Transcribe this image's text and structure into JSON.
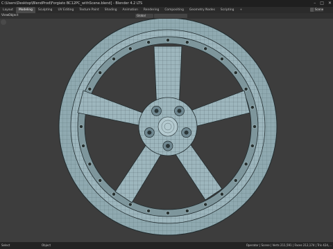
{
  "window": {
    "title": "C:\\Users\\Desktop\\BlendProd\\Forgiato BC12PC_withScene.blend] - Blender 4.2 LTS",
    "controls": [
      "–",
      "□",
      "✕"
    ]
  },
  "workspaces": {
    "tabs": [
      "Layout",
      "Modeling",
      "Sculpting",
      "UV Editing",
      "Texture Paint",
      "Shading",
      "Animation",
      "Rendering",
      "Compositing",
      "Geometry Nodes",
      "Scripting",
      "+"
    ],
    "active": "Modeling"
  },
  "scene": {
    "label": "Scene"
  },
  "viewport_header": {
    "menus": [
      "View",
      "Object"
    ],
    "orientation": "Global",
    "snap_icon": "magnet-icon"
  },
  "statusbar": {
    "left": "Select",
    "middle": "Object",
    "right": "Operator | Scene | Verts 211,591 | Faces 212,174 | Tris 424,..."
  },
  "colors": {
    "wheel": "#9db6bd",
    "wire": "#1f2a2d",
    "background": "#3d3d3d"
  }
}
